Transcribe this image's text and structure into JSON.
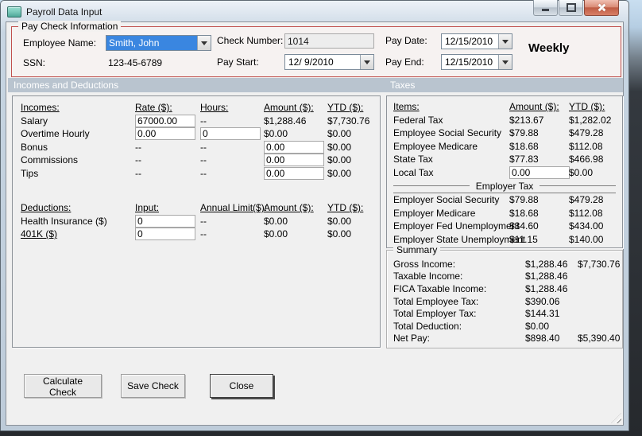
{
  "window": {
    "title": "Payroll Data Input"
  },
  "paycheck": {
    "title": "Pay Check Information",
    "employee_name_label": "Employee Name:",
    "employee_name": "Smith, John",
    "ssn_label": "SSN:",
    "ssn": "123-45-6789",
    "check_number_label": "Check Number:",
    "check_number": "1014",
    "pay_start_label": "Pay Start:",
    "pay_start": "12/ 9/2010",
    "pay_date_label": "Pay Date:",
    "pay_date": "12/15/2010",
    "pay_end_label": "Pay End:",
    "pay_end": "12/15/2010",
    "frequency": "Weekly"
  },
  "band": {
    "left": "Incomes and Deductions",
    "right": "Taxes"
  },
  "incomes_table": {
    "headers": {
      "c1": "Incomes:",
      "c2": "Rate ($):",
      "c3": "Hours:",
      "c4": "Amount ($):",
      "c5": "YTD ($):"
    },
    "rows": [
      {
        "label": "Salary",
        "rate": "67000.00",
        "hours": "--",
        "amount": "$1,288.46",
        "ytd": "$7,730.76"
      },
      {
        "label": "Overtime Hourly",
        "rate": "0.00",
        "hours": "0",
        "amount": "$0.00",
        "ytd": "$0.00"
      },
      {
        "label": "Bonus",
        "rate": "--",
        "hours": "--",
        "amount": "0.00",
        "ytd": "$0.00"
      },
      {
        "label": "Commissions",
        "rate": "--",
        "hours": "--",
        "amount": "0.00",
        "ytd": "$0.00"
      },
      {
        "label": "Tips",
        "rate": "--",
        "hours": "--",
        "amount": "0.00",
        "ytd": "$0.00"
      }
    ]
  },
  "deductions_table": {
    "headers": {
      "c1": "Deductions:",
      "c2": "Input:",
      "c3": "Annual Limit($):",
      "c4": "Amount ($):",
      "c5": "YTD ($):"
    },
    "rows": [
      {
        "label": "Health Insurance ($)",
        "input": "0",
        "limit": "--",
        "amount": "$0.00",
        "ytd": "$0.00"
      },
      {
        "label": "401K ($)",
        "input": "0",
        "limit": "--",
        "amount": "$0.00",
        "ytd": "$0.00"
      }
    ]
  },
  "taxes_table": {
    "headers": {
      "c1": "Items:",
      "c2": "Amount ($):",
      "c3": "YTD ($):"
    },
    "employee_rows": [
      {
        "label": "Federal Tax",
        "amount": "$213.67",
        "ytd": "$1,282.02"
      },
      {
        "label": "Employee Social Security",
        "amount": "$79.88",
        "ytd": "$479.28"
      },
      {
        "label": "Employee Medicare",
        "amount": "$18.68",
        "ytd": "$112.08"
      },
      {
        "label": "State Tax",
        "amount": "$77.83",
        "ytd": "$466.98"
      },
      {
        "label": "Local Tax",
        "amount": "0.00",
        "ytd": "$0.00"
      }
    ],
    "employer_divider": "Employer Tax",
    "employer_rows": [
      {
        "label": "Employer Social Security",
        "amount": "$79.88",
        "ytd": "$479.28"
      },
      {
        "label": "Employer Medicare",
        "amount": "$18.68",
        "ytd": "$112.08"
      },
      {
        "label": "Employer Fed Unemployment",
        "amount": "$34.60",
        "ytd": "$434.00"
      },
      {
        "label": "Employer State Unemployment",
        "amount": "$11.15",
        "ytd": "$140.00"
      }
    ]
  },
  "summary": {
    "title": "Summary",
    "rows": [
      {
        "label": "Gross Income:",
        "amount": "$1,288.46",
        "ytd": "$7,730.76"
      },
      {
        "label": "Taxable Income:",
        "amount": "$1,288.46",
        "ytd": ""
      },
      {
        "label": "FICA Taxable Income:",
        "amount": "$1,288.46",
        "ytd": ""
      },
      {
        "label": "Total Employee Tax:",
        "amount": "$390.06",
        "ytd": ""
      },
      {
        "label": "Total Employer Tax:",
        "amount": "$144.31",
        "ytd": ""
      },
      {
        "label": "Total Deduction:",
        "amount": "$0.00",
        "ytd": ""
      },
      {
        "label": "Net Pay:",
        "amount": "$898.40",
        "ytd": "$5,390.40"
      }
    ]
  },
  "buttons": {
    "calculate": "Calculate Check",
    "save": "Save Check",
    "close": "Close"
  },
  "colors": {
    "groupbox_border": "#C0504D",
    "section_band": "#B9C4CF",
    "selection_blue": "#3A86E0",
    "close_button_red": "#BE5A42"
  }
}
